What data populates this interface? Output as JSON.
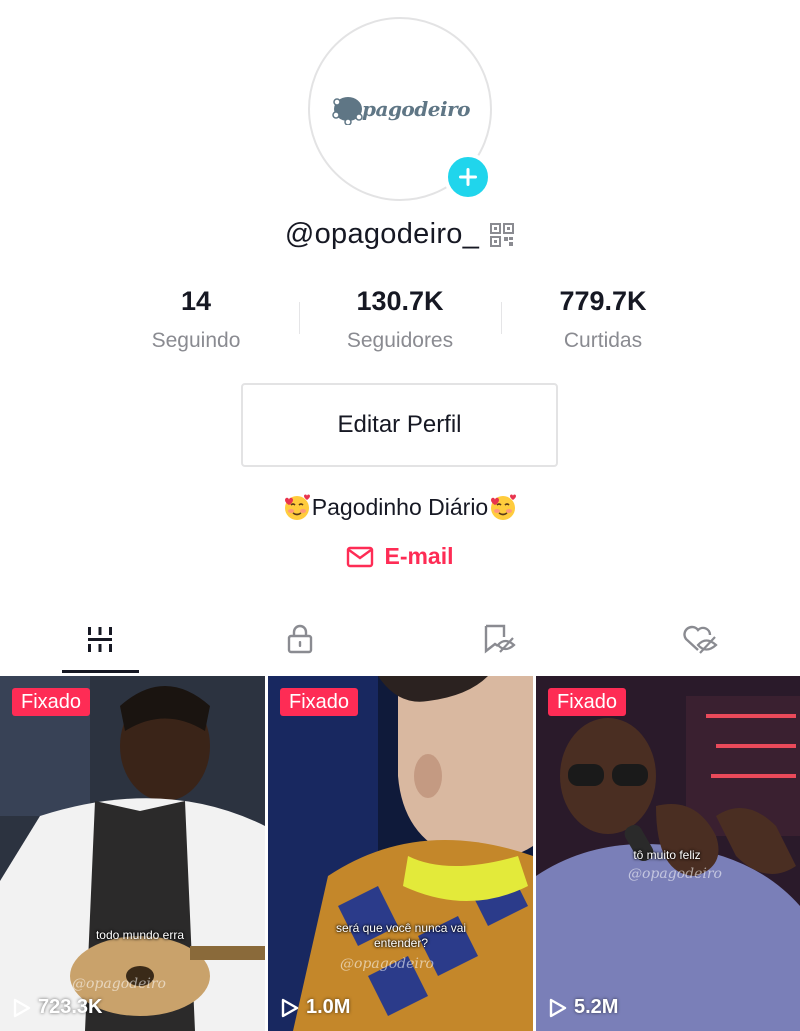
{
  "profile": {
    "logo_text": "pagodeiro",
    "username": "@opagodeiro_",
    "bio_text": "Pagodinho Diário",
    "email_label": "E-mail",
    "edit_button": "Editar Perfil"
  },
  "stats": [
    {
      "value": "14",
      "label": "Seguindo"
    },
    {
      "value": "130.7K",
      "label": "Seguidores"
    },
    {
      "value": "779.7K",
      "label": "Curtidas"
    }
  ],
  "tabs": [
    {
      "icon": "grid-icon"
    },
    {
      "icon": "lock-icon"
    },
    {
      "icon": "bookmark-eye-icon"
    },
    {
      "icon": "heart-eye-icon"
    }
  ],
  "videos": [
    {
      "pinned_label": "Fixado",
      "views": "723.3K",
      "caption": "todo mundo erra",
      "watermark": "@opagodeiro"
    },
    {
      "pinned_label": "Fixado",
      "views": "1.0M",
      "caption": "será que você nunca vai entender?",
      "watermark": "@opagodeiro"
    },
    {
      "pinned_label": "Fixado",
      "views": "5.2M",
      "caption": "tô muito feliz",
      "watermark": "@opagodeiro"
    }
  ],
  "colors": {
    "accent": "#fe2c55",
    "add_button": "#20d5ec",
    "text": "#161823",
    "muted": "#8a8b91"
  }
}
